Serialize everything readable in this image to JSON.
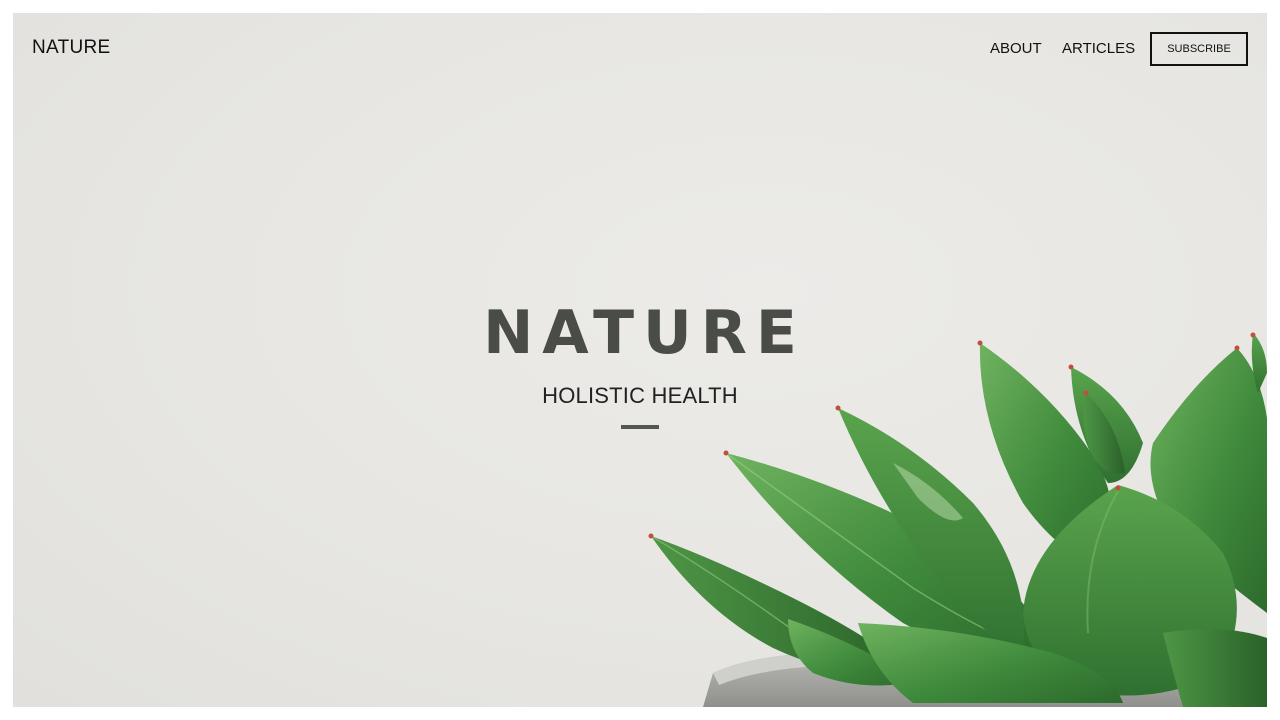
{
  "header": {
    "brand": "NATURE",
    "nav": {
      "about": "ABOUT",
      "articles": "ARTICLES"
    },
    "subscribe_label": "SUBSCRIBE"
  },
  "hero": {
    "title": "NATURE",
    "subtitle": "HOLISTIC HEALTH",
    "background_image": "succulent-plant-in-concrete-pot"
  },
  "colors": {
    "background": "#e7e6e2",
    "text": "#111111",
    "title": "#4a4d47",
    "accent_green": "#3f8a3c"
  }
}
